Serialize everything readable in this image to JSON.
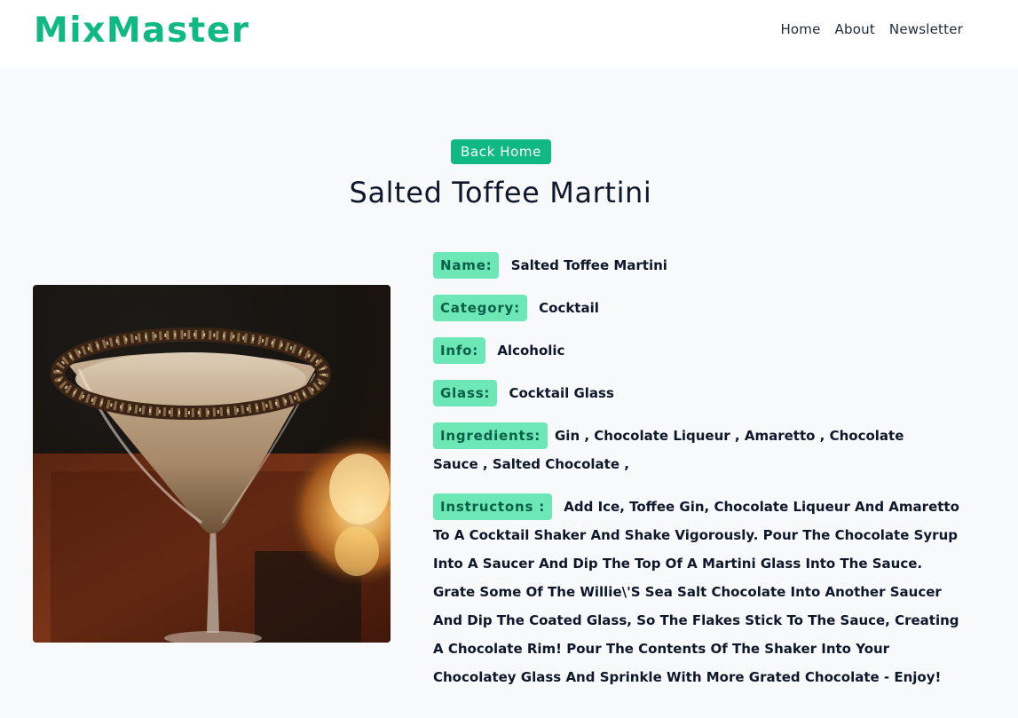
{
  "brand": {
    "name": "MixMaster",
    "color": "#10b981"
  },
  "nav": {
    "items": [
      "Home",
      "About",
      "Newsletter"
    ]
  },
  "actions": {
    "back_label": "Back Home"
  },
  "drink": {
    "title": "Salted Toffee Martini",
    "image_icon": "martini-photo",
    "fields": {
      "name_label": "Name:",
      "name_value": "Salted Toffee Martini",
      "category_label": "Category:",
      "category_value": "Cocktail",
      "info_label": "Info:",
      "info_value": "Alcoholic",
      "glass_label": "Glass:",
      "glass_value": "Cocktail Glass",
      "ingredients_label": "Ingredients:",
      "ingredients": [
        "Gin",
        "Chocolate Liqueur",
        "Amaretto",
        "Chocolate Sauce",
        "Salted Chocolate"
      ],
      "instructions_label": "Instructons :",
      "instructions_value": "Add Ice, Toffee Gin, Chocolate Liqueur And Amaretto To A Cocktail Shaker And Shake Vigorously. Pour The Chocolate Syrup Into A Saucer And Dip The Top Of A Martini Glass Into The Sauce. Grate Some Of The Willie\\'S Sea Salt Chocolate Into Another Saucer And Dip The Coated Glass, So The Flakes Stick To The Sauce, Creating A Chocolate Rim! Pour The Contents Of The Shaker Into Your Chocolatey Glass And Sprinkle With More Grated Chocolate - Enjoy!"
    }
  },
  "colors": {
    "label_bg": "#6ee7b7",
    "label_text": "#065f46",
    "page_bg": "#f8f9fa"
  }
}
